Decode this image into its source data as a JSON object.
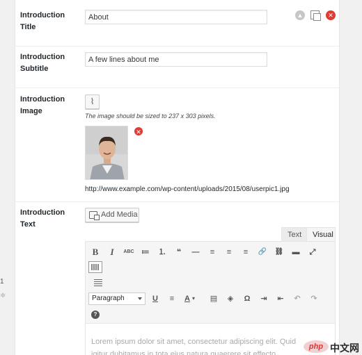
{
  "left_ghost": {
    "text1": "1",
    "text2": "≑"
  },
  "rows": {
    "title": {
      "label": "Introduction Title",
      "value": "About"
    },
    "subtitle": {
      "label": "Introduction Subtitle",
      "value": "A few lines about me"
    },
    "image": {
      "label": "Introduction Image",
      "hint": "The image should be sized to 237 x 303 pixels.",
      "url": "http://www.example.com/wp-content/uploads/2015/08/userpic1.jpg"
    },
    "text": {
      "label": "Introduction Text"
    }
  },
  "controls": {
    "up": "▲",
    "delete": "✕"
  },
  "clip_icon": "⌇",
  "thumb_delete": "✕",
  "add_media": {
    "label": "Add Media"
  },
  "editor": {
    "tabs": {
      "text": "Text",
      "visual": "Visual"
    },
    "row1": [
      "B",
      "I",
      "ABC",
      "≔",
      "⒈",
      "❝",
      "—",
      "≡",
      "≡",
      "≡",
      "🔗",
      "⛓",
      "▬",
      "⤢"
    ],
    "row3": [
      "U",
      "≡",
      "A",
      "▾",
      "▤",
      "◈",
      "Ω",
      "⇥",
      "⇤",
      "↶",
      "↷"
    ],
    "format_select": "Paragraph",
    "help": "?",
    "content_text": "Lorem ipsum dolor sit amet, consectetur adipiscing elit. Quid",
    "content_text2": "igitur dubitamus in tota eius natura quaerere sit effecto"
  },
  "watermark": {
    "php": "php",
    "cn": "中文网"
  }
}
